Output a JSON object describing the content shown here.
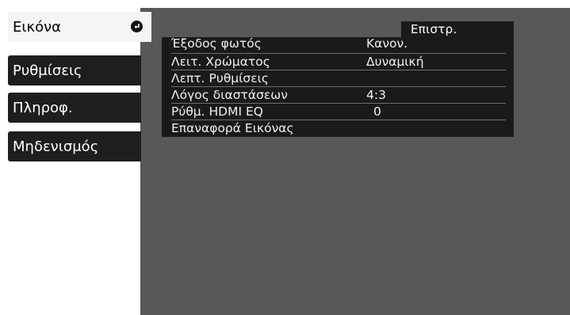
{
  "sidebar": {
    "items": [
      {
        "label": "Εικόνα",
        "active": true
      },
      {
        "label": "Ρυθμίσεις",
        "active": false
      },
      {
        "label": "Πληροφ.",
        "active": false
      },
      {
        "label": "Μηδενισμός",
        "active": false
      }
    ],
    "active_icon": "enter-arrow-icon"
  },
  "panel": {
    "back_label": "Επιστρ.",
    "rows": [
      {
        "label": "Έξοδος φωτός",
        "value": "Κανον."
      },
      {
        "label": "Λειτ. Χρώματος",
        "value": "Δυναμική"
      },
      {
        "label": "Λεπτ. Ρυθμίσεις",
        "value": ""
      },
      {
        "label": "Λόγος διαστάσεων",
        "value": "4:3"
      },
      {
        "label": "Ρύθμ. HDMI EQ",
        "value": "0"
      },
      {
        "label": "Επαναφορά Εικόνας",
        "value": ""
      }
    ]
  },
  "colors": {
    "background": "#585858",
    "menu_bg": "#1a1a1a",
    "tab_bg": "#1e1e1e",
    "active_tab_bg": "#f4f4f4",
    "text": "#f0f0f0"
  }
}
